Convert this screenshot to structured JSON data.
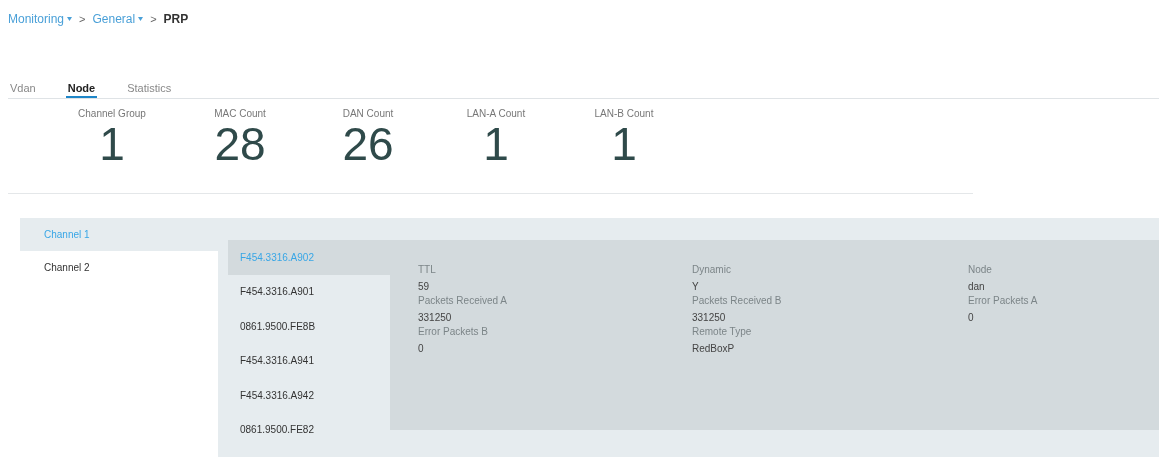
{
  "breadcrumb": {
    "items": [
      {
        "label": "Monitoring",
        "dropdown": true
      },
      {
        "label": "General",
        "dropdown": true
      },
      {
        "label": "PRP",
        "dropdown": false
      }
    ],
    "separator": ">"
  },
  "tabs": [
    {
      "label": "Vdan",
      "selected": false
    },
    {
      "label": "Node",
      "selected": true
    },
    {
      "label": "Statistics",
      "selected": false
    }
  ],
  "stats": [
    {
      "label": "Channel Group",
      "value": "1"
    },
    {
      "label": "MAC Count",
      "value": "28"
    },
    {
      "label": "DAN Count",
      "value": "26"
    },
    {
      "label": "LAN-A Count",
      "value": "1"
    },
    {
      "label": "LAN-B Count",
      "value": "1"
    }
  ],
  "channels": [
    {
      "label": "Channel 1",
      "selected": true
    },
    {
      "label": "Channel 2",
      "selected": false
    }
  ],
  "macs": [
    {
      "label": "F454.3316.A902",
      "selected": true
    },
    {
      "label": "F454.3316.A901",
      "selected": false
    },
    {
      "label": "0861.9500.FE8B",
      "selected": false
    },
    {
      "label": "F454.3316.A941",
      "selected": false
    },
    {
      "label": "F454.3316.A942",
      "selected": false
    },
    {
      "label": "0861.9500.FE82",
      "selected": false
    }
  ],
  "details": [
    {
      "label": "TTL",
      "value": "59"
    },
    {
      "label": "Dynamic",
      "value": "Y"
    },
    {
      "label": "Node",
      "value": "dan"
    },
    {
      "label": "Packets Received A",
      "value": "331250"
    },
    {
      "label": "Packets Received B",
      "value": "331250"
    },
    {
      "label": "Error Packets A",
      "value": "0"
    },
    {
      "label": "Error Packets B",
      "value": "0"
    },
    {
      "label": "Remote Type",
      "value": "RedBoxP"
    }
  ]
}
